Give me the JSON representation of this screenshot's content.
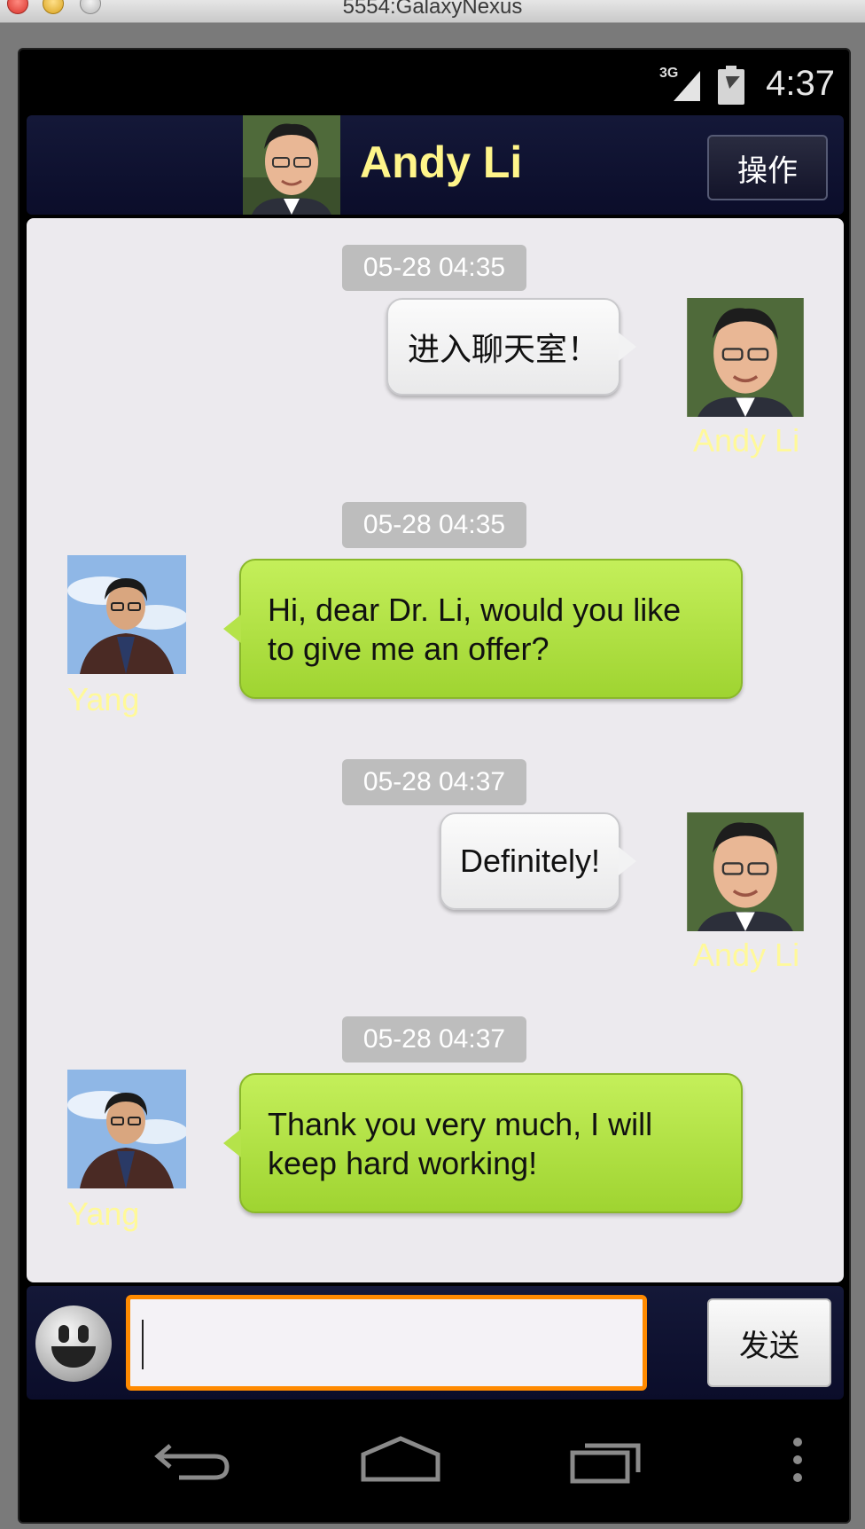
{
  "window": {
    "title": "5554:GalaxyNexus"
  },
  "status_bar": {
    "network": "3G",
    "time": "4:37"
  },
  "header": {
    "contact_name": "Andy Li",
    "action_label": "操作"
  },
  "messages": [
    {
      "time": "05-28 04:35",
      "sender": "Andy Li",
      "side": "right",
      "text": "进入聊天室！"
    },
    {
      "time": "05-28 04:35",
      "sender": "Yang",
      "side": "left",
      "text_lines": [
        "Hi, dear Dr. Li, would you like",
        "to give me an offer?"
      ]
    },
    {
      "time": "05-28 04:37",
      "sender": "Andy Li",
      "side": "right",
      "text": "Definitely!"
    },
    {
      "time": "05-28 04:37",
      "sender": "Yang",
      "side": "left",
      "text_lines": [
        "Thank you very much, I will",
        "keep hard working!"
      ]
    }
  ],
  "input": {
    "value": "",
    "send_label": "发送"
  },
  "colors": {
    "name_label": "#fff99a",
    "header_name": "#fff58a",
    "input_focus": "#ff8a00",
    "green_bubble": "#b5e34a"
  },
  "icons": {
    "emoji": "smiley-icon",
    "back": "back-icon",
    "home": "home-icon",
    "recents": "recents-icon",
    "menu": "overflow-menu-icon"
  }
}
